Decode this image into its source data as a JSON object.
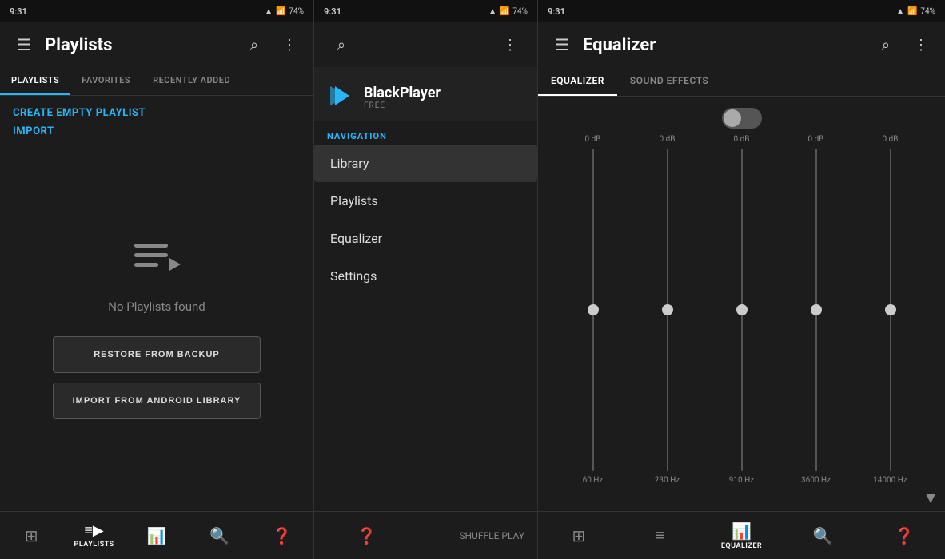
{
  "panel1": {
    "status": {
      "time": "9:31",
      "battery": "74%"
    },
    "toolbar": {
      "menu_icon": "☰",
      "title": "Playlists",
      "search_icon": "⌕",
      "more_icon": "⋮"
    },
    "tabs": [
      {
        "label": "PLAYLISTS",
        "active": true
      },
      {
        "label": "FAVORITES",
        "active": false
      },
      {
        "label": "RECENTLY ADDED",
        "active": false
      }
    ],
    "actions": {
      "create_label": "CREATE EMPTY PLAYLIST",
      "import_label": "IMPORT"
    },
    "empty_text": "No Playlists found",
    "restore_button": "RESTORE FROM BACKUP",
    "import_button": "IMPORT FROM ANDROID LIBRARY"
  },
  "panel1_bottom_nav": [
    {
      "icon": "🗂",
      "label": "",
      "active": false
    },
    {
      "icon": "≡▶",
      "label": "PLAYLISTS",
      "active": true
    },
    {
      "icon": "📊",
      "label": "",
      "active": false
    },
    {
      "icon": "🔍",
      "label": "",
      "active": false
    },
    {
      "icon": "❓",
      "label": "",
      "active": false
    }
  ],
  "panel2": {
    "status": {
      "time": "9:31",
      "battery": "74%"
    },
    "app_name": "BlackPlayer",
    "app_sub": "FREE",
    "navigation_label": "NAVIGATION",
    "items": [
      {
        "label": "Library",
        "active": true
      },
      {
        "label": "Playlists",
        "active": false
      },
      {
        "label": "Equalizer",
        "active": false
      },
      {
        "label": "Settings",
        "active": false
      }
    ]
  },
  "panel2_bottom_nav": [
    {
      "icon": "❓",
      "label": "",
      "active": false
    }
  ],
  "panel3": {
    "status": {
      "time": "9:31",
      "battery": "74%"
    },
    "toolbar": {
      "menu_icon": "☰",
      "title": "Equalizer",
      "search_icon": "⌕",
      "more_icon": "⋮"
    },
    "tabs": [
      {
        "label": "EQUALIZER",
        "active": true
      },
      {
        "label": "SOUND EFFECTS",
        "active": false
      }
    ],
    "bands": [
      {
        "db": "0 dB",
        "hz": "60 Hz",
        "position": 50
      },
      {
        "db": "0 dB",
        "hz": "230 Hz",
        "position": 50
      },
      {
        "db": "0 dB",
        "hz": "910 Hz",
        "position": 50
      },
      {
        "db": "0 dB",
        "hz": "3600 Hz",
        "position": 50
      },
      {
        "db": "0 dB",
        "hz": "14000 Hz",
        "position": 50
      }
    ]
  },
  "panel3_bottom_nav": [
    {
      "icon": "🗂",
      "label": "",
      "active": false
    },
    {
      "icon": "≡",
      "label": "",
      "active": false
    },
    {
      "icon": "📊",
      "label": "EQUALIZER",
      "active": true
    },
    {
      "icon": "🔍",
      "label": "",
      "active": false
    },
    {
      "icon": "❓",
      "label": "",
      "active": false
    }
  ]
}
